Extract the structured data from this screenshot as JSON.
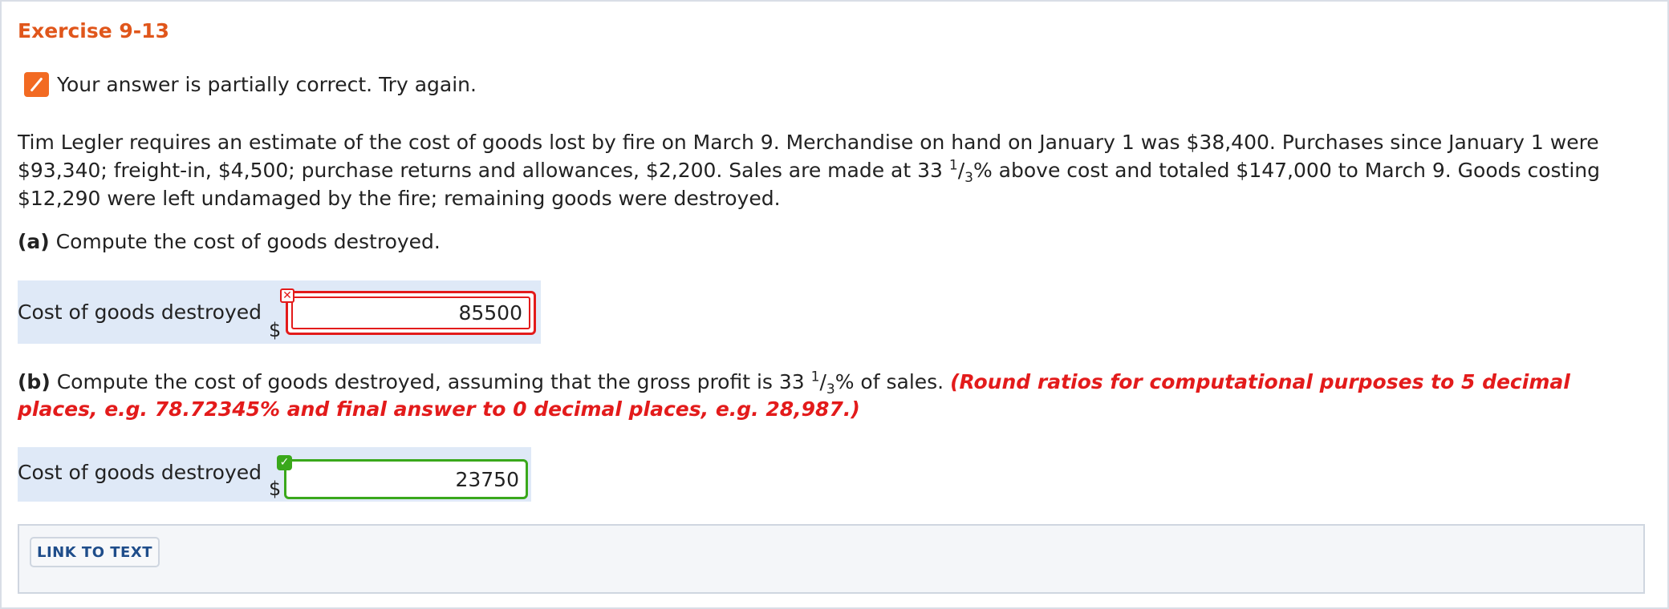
{
  "exercise": {
    "title": "Exercise 9-13"
  },
  "status": {
    "icon": "pencil-icon",
    "message": "Your answer is partially correct.  Try again."
  },
  "problem": {
    "text_before": "Tim Legler requires an estimate of the cost of goods lost by fire on March 9. Merchandise on hand on January 1 was $38,400. Purchases since January 1 were $93,340; freight-in, $4,500; purchase returns and allowances, $2,200. Sales are made at 33 ",
    "frac_num": "1",
    "frac_sep": "/",
    "frac_den": "3",
    "text_after": "% above cost and totaled $147,000 to March 9. Goods costing $12,290 were left undamaged by the fire; remaining goods were destroyed."
  },
  "part_a": {
    "tag": "(a)",
    "question": " Compute the cost of goods destroyed.",
    "label": "Cost of goods destroyed",
    "currency": "$",
    "value": "85500",
    "result": "incorrect",
    "result_icon": "x-icon"
  },
  "part_b": {
    "tag": "(b)",
    "question_before": " Compute the cost of goods destroyed, assuming that the gross profit is 33 ",
    "frac_num": "1",
    "frac_sep": "/",
    "frac_den": "3",
    "question_after": "% of sales. ",
    "hint": "(Round ratios for computational purposes to 5 decimal places, e.g. 78.72345% and final answer to 0 decimal places, e.g. 28,987.)",
    "label": "Cost of goods destroyed",
    "currency": "$",
    "value": "23750",
    "result": "correct",
    "result_icon": "check-icon"
  },
  "footer": {
    "link_label": "LINK TO TEXT"
  },
  "colors": {
    "title": "#e0561b",
    "incorrect": "#e31b1b",
    "correct": "#3aa81b",
    "answer_row_bg": "#dfe9f7",
    "link": "#1f4d8a"
  }
}
